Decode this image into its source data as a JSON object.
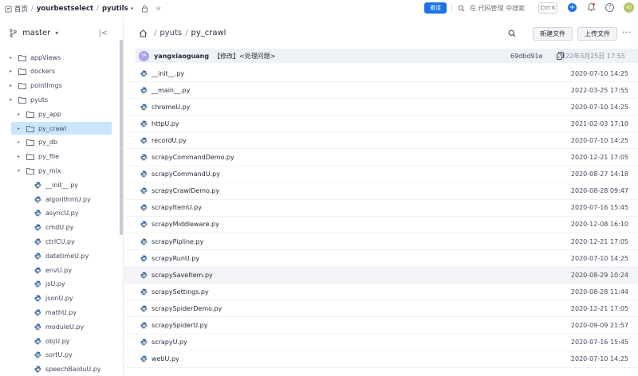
{
  "topbar": {
    "home": "首页",
    "owner": "yourbestselect",
    "repo": "pyutils",
    "invite": "邀请",
    "search_placeholder": "在 代码管理 中搜索",
    "shortcut": "Ctrl K",
    "avatar": "YO",
    "accent": "#1a73e8"
  },
  "sidebar": {
    "branch": "master",
    "tree": [
      {
        "label": "appViews",
        "type": "folder",
        "depth": 0,
        "expanded": false
      },
      {
        "label": "dockers",
        "type": "folder",
        "depth": 0,
        "expanded": false
      },
      {
        "label": "pointImgs",
        "type": "folder",
        "depth": 0,
        "expanded": false
      },
      {
        "label": "pyuts",
        "type": "folder",
        "depth": 0,
        "expanded": true
      },
      {
        "label": "py_app",
        "type": "folder",
        "depth": 1,
        "expanded": false
      },
      {
        "label": "py_crawl",
        "type": "folder",
        "depth": 1,
        "expanded": false,
        "selected": true
      },
      {
        "label": "py_db",
        "type": "folder",
        "depth": 1,
        "expanded": false
      },
      {
        "label": "py_file",
        "type": "folder",
        "depth": 1,
        "expanded": false
      },
      {
        "label": "py_mix",
        "type": "folder",
        "depth": 1,
        "expanded": true
      },
      {
        "label": "__init__.py",
        "type": "file",
        "depth": 2
      },
      {
        "label": "algorithmU.py",
        "type": "file",
        "depth": 2
      },
      {
        "label": "asyncU.py",
        "type": "file",
        "depth": 2
      },
      {
        "label": "cmdU.py",
        "type": "file",
        "depth": 2
      },
      {
        "label": "ctrlCU.py",
        "type": "file",
        "depth": 2
      },
      {
        "label": "datetimeU.py",
        "type": "file",
        "depth": 2
      },
      {
        "label": "envU.py",
        "type": "file",
        "depth": 2
      },
      {
        "label": "jsU.py",
        "type": "file",
        "depth": 2
      },
      {
        "label": "jsonU.py",
        "type": "file",
        "depth": 2
      },
      {
        "label": "mathU.py",
        "type": "file",
        "depth": 2
      },
      {
        "label": "moduleU.py",
        "type": "file",
        "depth": 2
      },
      {
        "label": "objU.py",
        "type": "file",
        "depth": 2
      },
      {
        "label": "sortU.py",
        "type": "file",
        "depth": 2
      },
      {
        "label": "speechBaiduU.py",
        "type": "file",
        "depth": 2
      }
    ]
  },
  "main": {
    "path": [
      "pyuts",
      "py_crawl"
    ],
    "new_file": "新建文件",
    "upload_file": "上传文件",
    "commit": {
      "avatar": "YA",
      "author": "yangxiaoguang",
      "message": "【修改】<处理问题>",
      "hash": "69dbd91e",
      "date": "2022年3月25日 17:55"
    },
    "files": [
      {
        "name": "__init__.py",
        "date": "2020-07-10 14:25"
      },
      {
        "name": "__main__.py",
        "date": "2022-03-25 17:55"
      },
      {
        "name": "chromeU.py",
        "date": "2020-07-10 14:25"
      },
      {
        "name": "httpU.py",
        "date": "2021-02-03 17:10"
      },
      {
        "name": "recordU.py",
        "date": "2020-07-10 14:25"
      },
      {
        "name": "scrapyCommandDemo.py",
        "date": "2020-12-21 17:05"
      },
      {
        "name": "scrapyCommandU.py",
        "date": "2020-08-27 14:18"
      },
      {
        "name": "scrapyCrawlDemo.py",
        "date": "2020-08-28 09:47"
      },
      {
        "name": "scrapyItemU.py",
        "date": "2020-07-16 15:45"
      },
      {
        "name": "scrapyMiddleware.py",
        "date": "2020-12-08 16:10"
      },
      {
        "name": "scrapyPipline.py",
        "date": "2020-12-21 17:05"
      },
      {
        "name": "scrapyRunU.py",
        "date": "2020-07-10 14:25"
      },
      {
        "name": "scrapySaveItem.py",
        "date": "2020-08-29 10:24"
      },
      {
        "name": "scrapySettings.py",
        "date": "2020-08-28 11:44"
      },
      {
        "name": "scrapySpiderDemo.py",
        "date": "2020-12-21 17:05"
      },
      {
        "name": "scrapySpiderU.py",
        "date": "2020-09-09 21:57"
      },
      {
        "name": "scrapyU.py",
        "date": "2020-07-16 15:45"
      },
      {
        "name": "webU.py",
        "date": "2020-07-10 14:25"
      }
    ]
  }
}
